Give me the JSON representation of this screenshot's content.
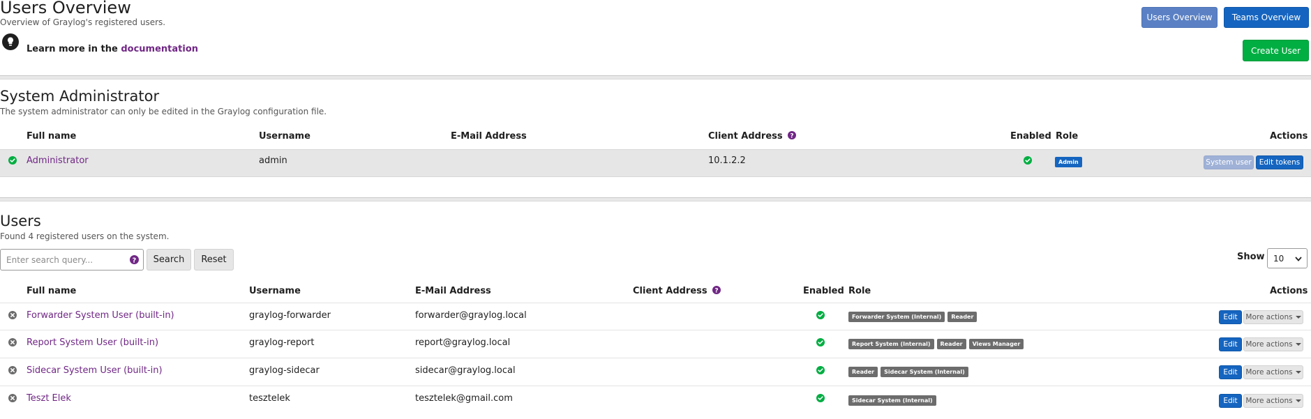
{
  "header": {
    "title": "Users Overview",
    "subtitle": "Overview of Graylog's registered users.",
    "learn_more_prefix": "Learn more in the",
    "learn_more_link": "documentation",
    "users_overview_button": "Users Overview",
    "teams_overview_button": "Teams Overview",
    "create_user_button": "Create User"
  },
  "system_admin": {
    "title": "System Administrator",
    "subtitle": "The system administrator can only be edited in the Graylog configuration file.",
    "columns": {
      "full_name": "Full name",
      "username": "Username",
      "email": "E-Mail Address",
      "client_address": "Client Address",
      "enabled": "Enabled",
      "role": "Role",
      "actions": "Actions"
    },
    "row": {
      "full_name": "Administrator",
      "username": "admin",
      "email": "",
      "client_address": "10.1.2.2",
      "role": "Admin",
      "system_user_button": "System user",
      "edit_tokens_button": "Edit tokens"
    }
  },
  "users": {
    "title": "Users",
    "subtitle": "Found 4 registered users on the system.",
    "search_placeholder": "Enter search query...",
    "search_button": "Search",
    "reset_button": "Reset",
    "show_label": "Show",
    "page_size": "10",
    "columns": {
      "full_name": "Full name",
      "username": "Username",
      "email": "E-Mail Address",
      "client_address": "Client Address",
      "enabled": "Enabled",
      "role": "Role",
      "actions": "Actions"
    },
    "edit_label": "Edit",
    "more_actions_label": "More actions",
    "rows": [
      {
        "full_name": "Forwarder System User (built-in)",
        "username": "graylog-forwarder",
        "email": "forwarder@graylog.local",
        "roles": [
          "Forwarder System (Internal)",
          "Reader"
        ]
      },
      {
        "full_name": "Report System User (built-in)",
        "username": "graylog-report",
        "email": "report@graylog.local",
        "roles": [
          "Report System (Internal)",
          "Reader",
          "Views Manager"
        ]
      },
      {
        "full_name": "Sidecar System User (built-in)",
        "username": "graylog-sidecar",
        "email": "sidecar@graylog.local",
        "roles": [
          "Reader",
          "Sidecar System (Internal)"
        ]
      },
      {
        "full_name": "Teszt Elek",
        "username": "tesztelek",
        "email": "tesztelek@gmail.com",
        "roles": [
          "Sidecar System (Internal)"
        ]
      }
    ]
  },
  "colors": {
    "link_purple": "#702785",
    "primary_blue": "#1565c0",
    "success_green": "#00ae42",
    "enabled_check_green": "#00ae42"
  }
}
